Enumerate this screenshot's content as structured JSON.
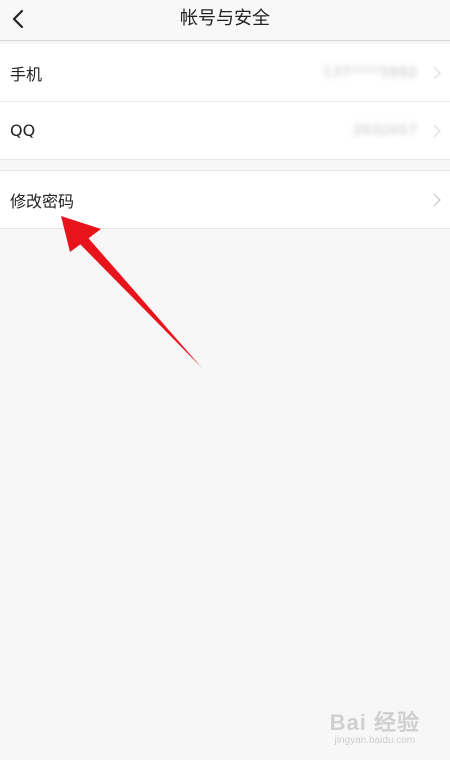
{
  "header": {
    "title": "帐号与安全",
    "back_icon": "chevron-left-icon"
  },
  "account_rows": [
    {
      "label": "手机",
      "value": "137****5882",
      "chevron_icon": "chevron-right-icon"
    },
    {
      "label": "QQ",
      "value": "2632057",
      "chevron_icon": "chevron-right-icon"
    }
  ],
  "password_row": {
    "label": "修改密码",
    "chevron_icon": "chevron-right-icon"
  },
  "annotation": {
    "type": "red-arrow",
    "color": "#e8141b",
    "points_to": "修改密码"
  },
  "watermark": {
    "brand": "Bai 经验",
    "url": "jingyan.baidu.com"
  },
  "colors": {
    "background": "#f7f7f7",
    "row_bg": "#ffffff",
    "divider": "#e6e6e6",
    "arrow": "#e8141b"
  }
}
